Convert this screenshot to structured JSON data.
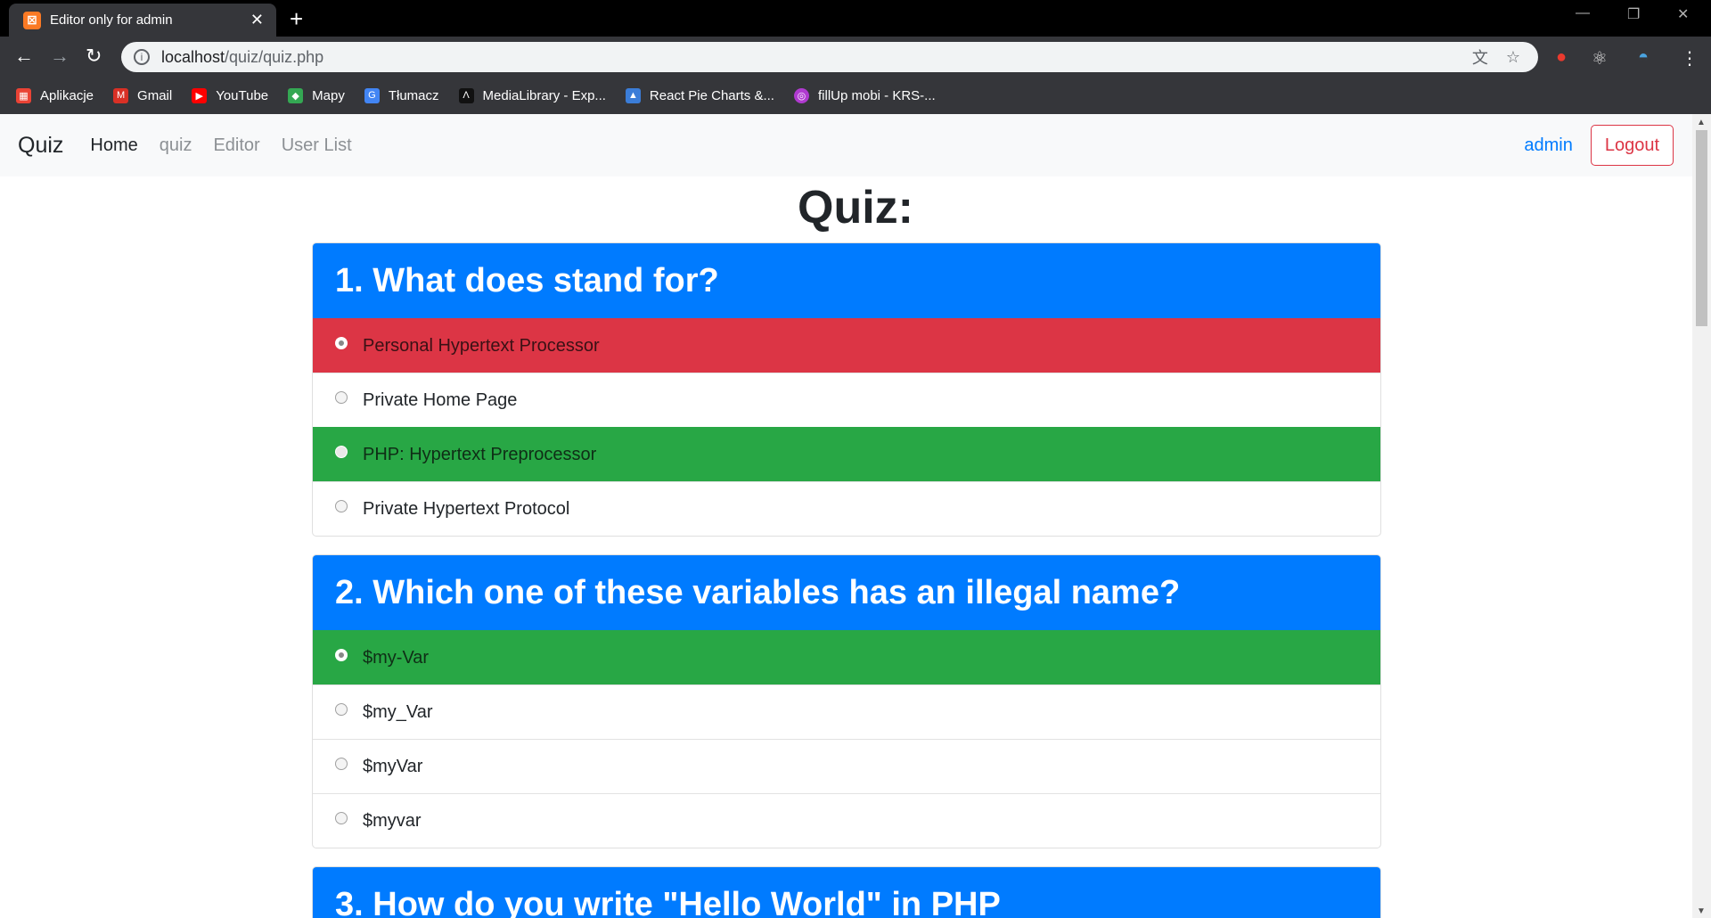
{
  "browser": {
    "tab_title": "Editor only for admin",
    "favicon_text": "⊠",
    "url_host": "localhost",
    "url_path": "/quiz/quiz.php",
    "bookmarks": [
      {
        "label": "Aplikacje",
        "icon": "apps-grid-icon",
        "color": "#ea4335"
      },
      {
        "label": "Gmail",
        "icon": "gmail-icon",
        "color": "#d93025"
      },
      {
        "label": "YouTube",
        "icon": "youtube-icon",
        "color": "#ff0000"
      },
      {
        "label": "Mapy",
        "icon": "maps-icon",
        "color": "#34a853"
      },
      {
        "label": "Tłumacz",
        "icon": "translate-icon",
        "color": "#4285f4"
      },
      {
        "label": "MediaLibrary - Exp...",
        "icon": "medialibrary-icon",
        "color": "#000000"
      },
      {
        "label": "React Pie Charts &...",
        "icon": "react-pie-icon",
        "color": "#3b7dd8"
      },
      {
        "label": "fillUp mobi - KRS-...",
        "icon": "fillup-icon",
        "color": "#b03ad0"
      }
    ]
  },
  "navbar": {
    "brand": "Quiz",
    "links": [
      {
        "label": "Home",
        "active": true
      },
      {
        "label": "quiz",
        "active": false
      },
      {
        "label": "Editor",
        "active": false
      },
      {
        "label": "User List",
        "active": false
      }
    ],
    "user": "admin",
    "logout": "Logout"
  },
  "page": {
    "title": "Quiz:"
  },
  "questions": [
    {
      "title": "1. What does stand for?",
      "answers": [
        {
          "text": "Personal Hypertext Processor",
          "state": "red",
          "checked": true
        },
        {
          "text": "Private Home Page",
          "state": "none",
          "checked": false
        },
        {
          "text": "PHP: Hypertext Preprocessor",
          "state": "green",
          "checked": false
        },
        {
          "text": "Private Hypertext Protocol",
          "state": "none",
          "checked": false
        }
      ]
    },
    {
      "title": "2. Which one of these variables has an illegal name?",
      "answers": [
        {
          "text": "$my-Var",
          "state": "green",
          "checked": true
        },
        {
          "text": "$my_Var",
          "state": "none",
          "checked": false
        },
        {
          "text": "$myVar",
          "state": "none",
          "checked": false
        },
        {
          "text": "$myvar",
          "state": "none",
          "checked": false
        }
      ]
    },
    {
      "title": "3. How do you write \"Hello World\" in PHP",
      "answers": []
    }
  ],
  "colors": {
    "primary": "#007bff",
    "wrong": "#dc3545",
    "correct": "#28a745"
  }
}
